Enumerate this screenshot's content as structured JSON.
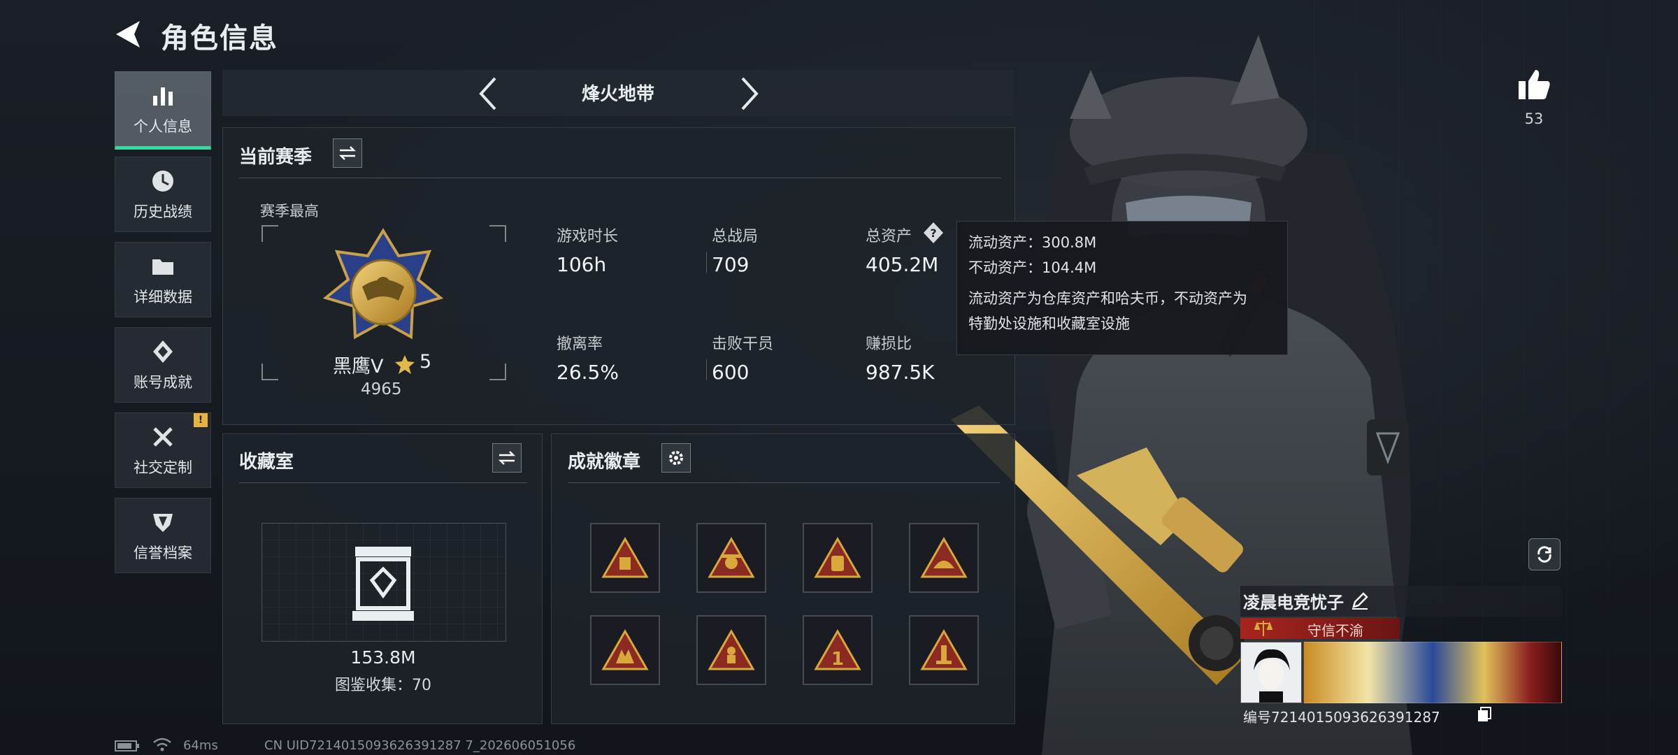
{
  "header": {
    "title": "角色信息"
  },
  "nav": [
    {
      "label": "个人信息",
      "icon": "bar-chart-icon",
      "active": true
    },
    {
      "label": "历史战绩",
      "icon": "clock-icon"
    },
    {
      "label": "详细数据",
      "icon": "folder-icon"
    },
    {
      "label": "账号成就",
      "icon": "diamond-icon"
    },
    {
      "label": "社交定制",
      "icon": "tools-icon",
      "badge": "!"
    },
    {
      "label": "信誉档案",
      "icon": "shield-icon"
    }
  ],
  "mode": {
    "label": "烽火地带"
  },
  "season": {
    "title": "当前赛季",
    "best_label": "赛季最高",
    "rank_name": "黑鹰Ⅴ",
    "rank_stars": "5",
    "rank_points": "4965",
    "stats": [
      {
        "label": "游戏时长",
        "value": "106h"
      },
      {
        "label": "总战局",
        "value": "709"
      },
      {
        "label": "总资产",
        "value": "405.2M"
      },
      {
        "label": "撤离率",
        "value": "26.5%"
      },
      {
        "label": "击败干员",
        "value": "600"
      },
      {
        "label": "赚损比",
        "value": "987.5K"
      }
    ]
  },
  "tooltip": {
    "liquid": "流动资产：300.8M",
    "fixed": "不动资产：104.4M",
    "desc1": "流动资产为仓库资产和哈夫币，不动资产为",
    "desc2": "特勤处设施和收藏室设施"
  },
  "collection": {
    "title": "收藏室",
    "value": "153.8M",
    "count": "图鉴收集：70"
  },
  "achievements": {
    "title": "成就徽章",
    "badges": [
      1,
      2,
      3,
      4,
      5,
      6,
      7,
      8
    ]
  },
  "likes": {
    "count": "53"
  },
  "player": {
    "name": "凌晨电竞忧子",
    "motto": "守信不渝",
    "id": "编号7214015093626391287"
  },
  "status_bar": {
    "ping": "64ms",
    "uid": "CN UID7214015093626391287 7_202606051056"
  },
  "colors": {
    "accent": "#39d6a0",
    "gold": "#d8a83a",
    "badge_red": "#8a2a22"
  }
}
